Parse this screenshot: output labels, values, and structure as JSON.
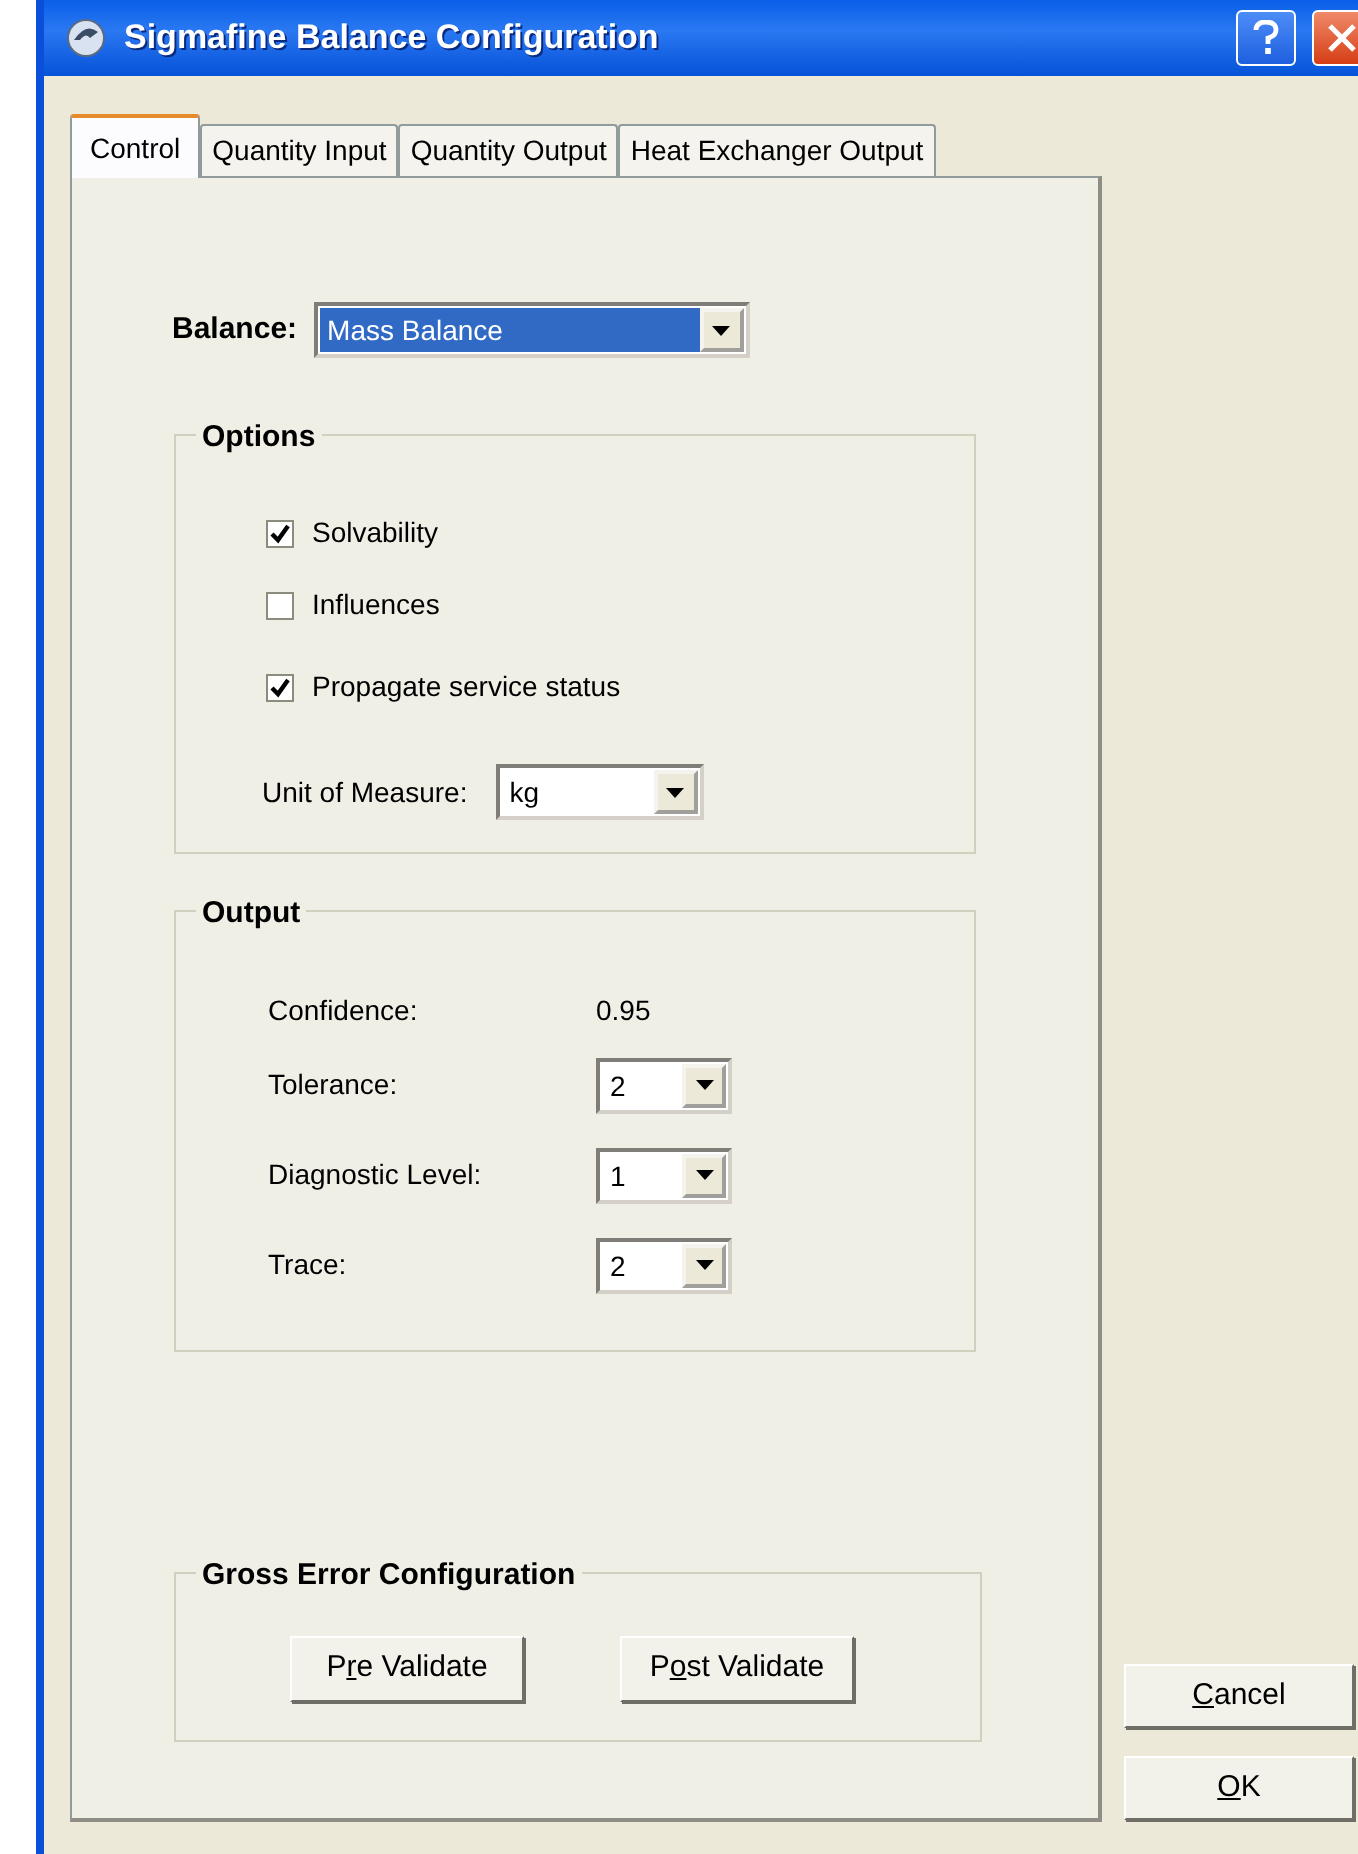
{
  "window": {
    "title": "Sigmafine Balance Configuration"
  },
  "tabs": [
    {
      "label": "Control",
      "selected": true
    },
    {
      "label": "Quantity Input",
      "selected": false
    },
    {
      "label": "Quantity Output",
      "selected": false
    },
    {
      "label": "Heat Exchanger Output",
      "selected": false
    }
  ],
  "balance": {
    "label": "Balance:",
    "value": "Mass Balance",
    "highlighted": true
  },
  "options": {
    "title": "Options",
    "checkboxes": [
      {
        "label": "Solvability",
        "checked": true
      },
      {
        "label": "Influences",
        "checked": false
      },
      {
        "label": "Propagate service status",
        "checked": true
      }
    ],
    "unit": {
      "label": "Unit of Measure:",
      "value": "kg"
    }
  },
  "output": {
    "title": "Output",
    "rows": [
      {
        "kind": "text",
        "label": "Confidence:",
        "value": "0.95"
      },
      {
        "kind": "combo",
        "label": "Tolerance:",
        "value": "2"
      },
      {
        "kind": "combo",
        "label": "Diagnostic Level:",
        "value": "1"
      },
      {
        "kind": "combo",
        "label": "Trace:",
        "value": "2"
      }
    ]
  },
  "gross_error": {
    "title": "Gross Error Configuration",
    "buttons": [
      {
        "before": "P",
        "key": "r",
        "after": "e Validate"
      },
      {
        "before": "P",
        "key": "o",
        "after": "st Validate"
      }
    ]
  },
  "dialog_buttons": [
    {
      "key": "C",
      "after": "ancel"
    },
    {
      "key": "O",
      "after": "K"
    }
  ]
}
